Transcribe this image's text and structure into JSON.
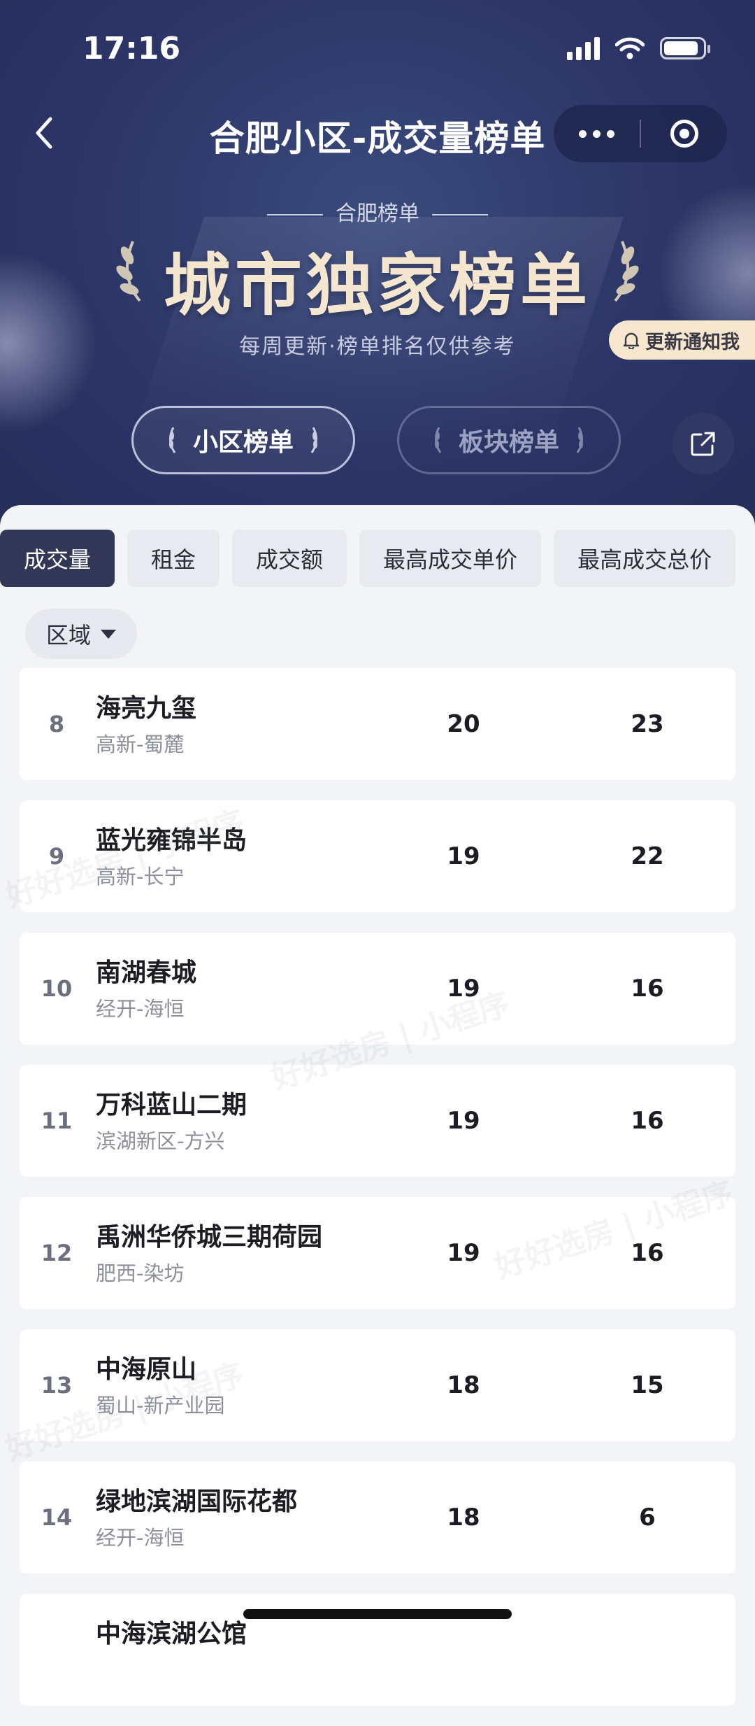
{
  "status": {
    "time": "17:16"
  },
  "nav": {
    "title": "合肥小区-成交量榜单"
  },
  "hero": {
    "subtitle": "合肥榜单",
    "title": "城市独家榜单",
    "note": "每周更新·榜单排名仅供参考",
    "notify_label": "更新通知我",
    "switch_active": "小区榜单",
    "switch_inactive": "板块榜单"
  },
  "tabs": [
    "成交量",
    "租金",
    "成交额",
    "最高成交单价",
    "最高成交总价"
  ],
  "filter": {
    "label": "区域"
  },
  "rows": [
    {
      "rank": "8",
      "name": "海亮九玺",
      "area": "高新-蜀麓",
      "v1": "20",
      "v2": "23"
    },
    {
      "rank": "9",
      "name": "蓝光雍锦半岛",
      "area": "高新-长宁",
      "v1": "19",
      "v2": "22"
    },
    {
      "rank": "10",
      "name": "南湖春城",
      "area": "经开-海恒",
      "v1": "19",
      "v2": "16"
    },
    {
      "rank": "11",
      "name": "万科蓝山二期",
      "area": "滨湖新区-方兴",
      "v1": "19",
      "v2": "16"
    },
    {
      "rank": "12",
      "name": "禹洲华侨城三期荷园",
      "area": "肥西-染坊",
      "v1": "19",
      "v2": "16"
    },
    {
      "rank": "13",
      "name": "中海原山",
      "area": "蜀山-新产业园",
      "v1": "18",
      "v2": "15"
    },
    {
      "rank": "14",
      "name": "绿地滨湖国际花都",
      "area": "经开-海恒",
      "v1": "18",
      "v2": "6"
    },
    {
      "rank": "",
      "name": "中海滨湖公馆",
      "area": "",
      "v1": "",
      "v2": ""
    }
  ],
  "watermark": "好好选房 | 小程序",
  "colors": {
    "hero_bg": "#2c3566",
    "active_tab": "#323657",
    "gold_text": "#f4e6cf"
  }
}
